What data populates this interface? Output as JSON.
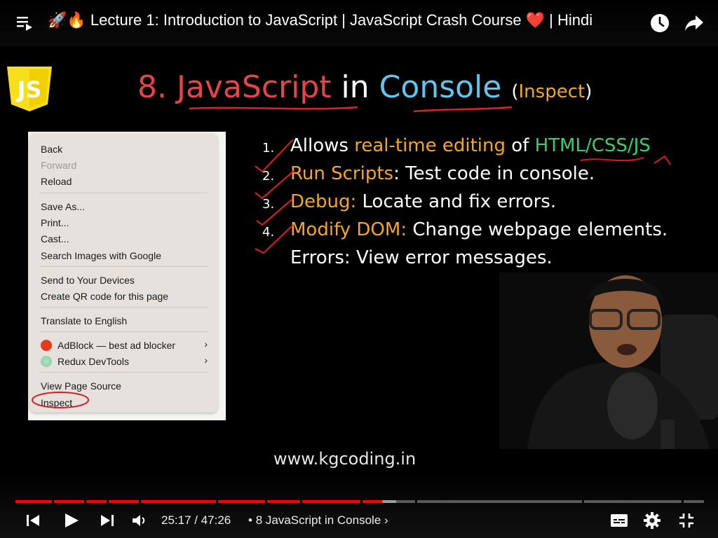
{
  "header": {
    "title": "🚀🔥 Lecture 1: Introduction to JavaScript | JavaScript Crash Course ❤️ | Hindi"
  },
  "slide": {
    "logo_text": "JS",
    "heading": {
      "number": "8.",
      "javascript": "JavaScript",
      "in": "in",
      "console": "Console",
      "paren_open": "(",
      "inspect": "Inspect",
      "paren_close": ")"
    },
    "context_menu": {
      "items": [
        {
          "label": "Back",
          "enabled": true
        },
        {
          "label": "Forward",
          "enabled": false
        },
        {
          "label": "Reload",
          "enabled": true
        },
        {
          "label": "Save As...",
          "enabled": true
        },
        {
          "label": "Print...",
          "enabled": true
        },
        {
          "label": "Cast...",
          "enabled": true
        },
        {
          "label": "Search Images with Google",
          "enabled": true
        },
        {
          "label": "Send to Your Devices",
          "enabled": true
        },
        {
          "label": "Create QR code for this page",
          "enabled": true
        },
        {
          "label": "Translate to English",
          "enabled": true
        },
        {
          "label": "AdBlock — best ad blocker",
          "enabled": true,
          "submenu": true
        },
        {
          "label": "Redux DevTools",
          "enabled": true,
          "submenu": true
        },
        {
          "label": "View Page Source",
          "enabled": true
        },
        {
          "label": "Inspect",
          "enabled": true
        }
      ]
    },
    "points": [
      {
        "num": "1.",
        "a": "Allows ",
        "b": "real-time editing",
        "c": " of ",
        "d": "HTML/CSS/JS"
      },
      {
        "num": "2.",
        "a": "Run Scripts",
        "b": ": Test code in console."
      },
      {
        "num": "3.",
        "a": "Debug:",
        "b": " Locate and fix errors."
      },
      {
        "num": "4.",
        "a": "Modify DOM:",
        "b": " Change webpage elements."
      },
      {
        "num": "",
        "a": "",
        "b": "Errors: View error messages."
      }
    ],
    "url": "www.kgcoding.in"
  },
  "player": {
    "time_current": "25:17",
    "time_separator": " / ",
    "time_total": "47:26",
    "chapter_bullet": " • ",
    "chapter": "8 JavaScript in Console",
    "chapter_chevron": "›",
    "progress_fraction": 0.533,
    "buffered_fraction": 0.553,
    "colors": {
      "played": "#ff0000",
      "buffered": "#9e9e9e",
      "unplayed": "#5a5a5a"
    }
  },
  "icons": [
    "playlist-icon",
    "watch-later-icon",
    "share-icon",
    "previous-icon",
    "play-icon",
    "next-icon",
    "volume-icon",
    "subtitles-icon",
    "settings-icon",
    "exit-fullscreen-icon"
  ]
}
